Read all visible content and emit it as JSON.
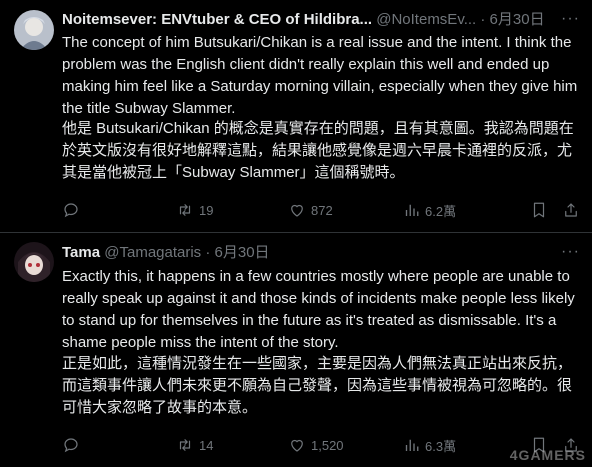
{
  "posts": [
    {
      "author_name": "Noitemsever: ENVtuber & CEO of Hildibra...",
      "author_handle": "@NoItemsEv...",
      "separator": "·",
      "date": "6月30日",
      "text_en": "The concept of him Butsukari/Chikan is a real issue and the intent. I think the problem was the English client didn't really explain this well and ended up making him feel like a Saturday morning villain, especially when they give him the title Subway Slammer.",
      "text_zh": "他是 Butsukari/Chikan 的概念是真實存在的問題，且有其意圖。我認為問題在於英文版沒有很好地解釋這點，結果讓他感覺像是週六早晨卡通裡的反派，尤其是當他被冠上「Subway Slammer」這個稱號時。",
      "reply_count": "",
      "retweet_count": "19",
      "like_count": "872",
      "view_count": "6.2萬",
      "avatar_colors": [
        "#cfd4dc",
        "#6e7b8f"
      ]
    },
    {
      "author_name": "Tama",
      "author_handle": "@Tamagataris",
      "separator": "·",
      "date": "6月30日",
      "text_en": "Exactly this, it happens in a few countries mostly where people are unable to really speak up against it and those kinds of incidents make people less likely to stand up for themselves in the future as it's treated as dismissable. It's a shame people miss the intent of the story.",
      "text_zh": "正是如此，這種情況發生在一些國家，主要是因為人們無法真正站出來反抗，而這類事件讓人們未來更不願為自己發聲，因為這些事情被視為可忽略的。很可惜大家忽略了故事的本意。",
      "reply_count": "",
      "retweet_count": "14",
      "like_count": "1,520",
      "view_count": "6.3萬",
      "avatar_colors": [
        "#2a1d24",
        "#b0303a"
      ]
    }
  ],
  "watermark": "4GAMERS",
  "icons": {
    "reply": "reply-icon",
    "retweet": "retweet-icon",
    "like": "heart-icon",
    "views": "views-chart-icon",
    "bookmark": "bookmark-icon",
    "share": "share-icon",
    "more": "more-icon"
  },
  "colors": {
    "background": "#000000",
    "text": "#e7e9ea",
    "muted": "#71767b",
    "divider": "#2f3336"
  }
}
